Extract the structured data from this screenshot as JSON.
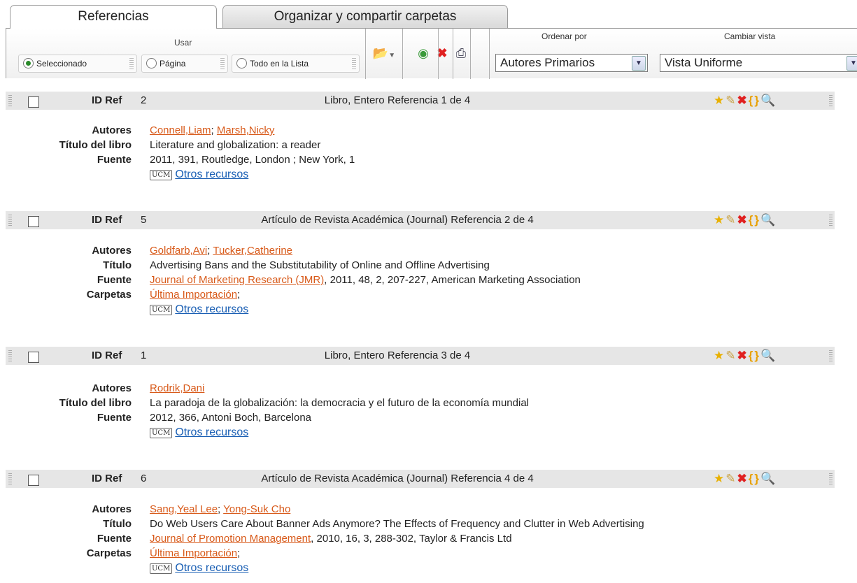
{
  "tabs": {
    "active": "Referencias",
    "inactive": "Organizar y compartir carpetas"
  },
  "toolbar": {
    "usar_label": "Usar",
    "radios": {
      "selected": "Seleccionado",
      "page": "Página",
      "all": "Todo en la Lista"
    },
    "sort_label": "Ordenar por",
    "sort_value": "Autores Primarios",
    "view_label": "Cambiar vista",
    "view_value": "Vista Uniforme"
  },
  "labels": {
    "idref": "ID Ref",
    "other_resources": "Otros recursos",
    "ucm": "UCM"
  },
  "refs": [
    {
      "id": "2",
      "desc": "Libro, Entero Referencia 1 de 4",
      "f0_label": "Autores",
      "author1": "Connell,Liam",
      "sep": ";",
      "author2": "Marsh,Nicky",
      "f1_label": "Título del libro",
      "f1_value": "Literature and globalization: a reader",
      "f2_label": "Fuente",
      "f2_value": "2011, 391, Routledge, London ; New York, 1"
    },
    {
      "id": "5",
      "desc": "Artículo de Revista Académica (Journal) Referencia 2 de 4",
      "f0_label": "Autores",
      "author1": "Goldfarb,Avi",
      "sep": ";",
      "author2": "Tucker,Catherine",
      "f1_label": "Título",
      "f1_value": "Advertising Bans and the Substitutability of Online and Offline Advertising",
      "f2_label": "Fuente",
      "f2_link": "Journal of Marketing Research (JMR)",
      "f2_rest": ", 2011, 48, 2, 207-227, American Marketing Association",
      "f3_label": "Carpetas",
      "f3_link": "Última Importación",
      "f3_rest": ";"
    },
    {
      "id": "1",
      "desc": "Libro, Entero Referencia 3 de 4",
      "f0_label": "Autores",
      "author1": "Rodrik,Dani",
      "f1_label": "Título del libro",
      "f1_value": "La paradoja de la globalización: la democracia y el futuro de la economía mundial",
      "f2_label": "Fuente",
      "f2_value": "2012, 366, Antoni Boch, Barcelona"
    },
    {
      "id": "6",
      "desc": "Artículo de Revista Académica (Journal) Referencia 4 de 4",
      "f0_label": "Autores",
      "author1": "Sang,Yeal Lee",
      "sep": ";",
      "author2": "Yong-Suk Cho",
      "f1_label": "Título",
      "f1_value": "Do Web Users Care About Banner Ads Anymore? The Effects of Frequency and Clutter in Web Advertising",
      "f2_label": "Fuente",
      "f2_link": "Journal of Promotion Management",
      "f2_rest": ", 2010, 16, 3, 288-302, Taylor & Francis Ltd",
      "f3_label": "Carpetas",
      "f3_link": "Última Importación",
      "f3_rest": ";"
    }
  ]
}
